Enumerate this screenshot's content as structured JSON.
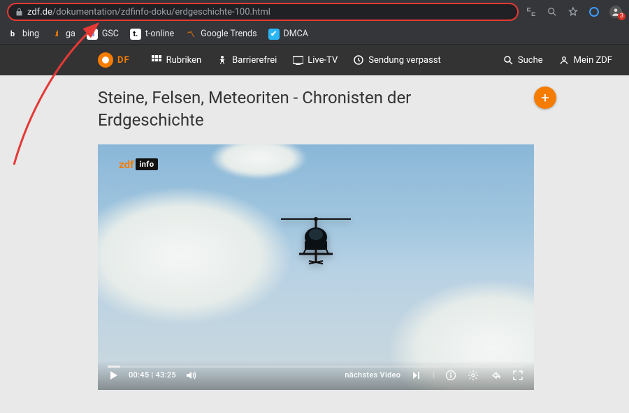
{
  "browser": {
    "url_host": "zdf.de",
    "url_path": "/dokumentation/zdfinfo-doku/erdgeschichte-100.html",
    "extensions_badge": "3"
  },
  "bookmarks": {
    "bing": "bing",
    "ga": "ga",
    "gsc": "GSC",
    "tonline": "t-online",
    "google_trends": "Google Trends",
    "dmca": "DMCA"
  },
  "zdf_nav": {
    "logo_text": "DF",
    "rubriken": "Rubriken",
    "barrierefrei": "Barrierefrei",
    "live_tv": "Live-TV",
    "sendung_verpasst": "Sendung verpasst",
    "suche": "Suche",
    "mein_zdf": "Mein ZDF"
  },
  "content": {
    "title": "Steine, Felsen, Meteoriten - Chronisten der Erdgeschichte",
    "fab_label": "+"
  },
  "player": {
    "watermark_brand": "zdf",
    "watermark_sub": "info",
    "current_time": "00:45",
    "duration": "43:25",
    "time_separator": " | ",
    "next_video_label": "nächstes Video"
  }
}
